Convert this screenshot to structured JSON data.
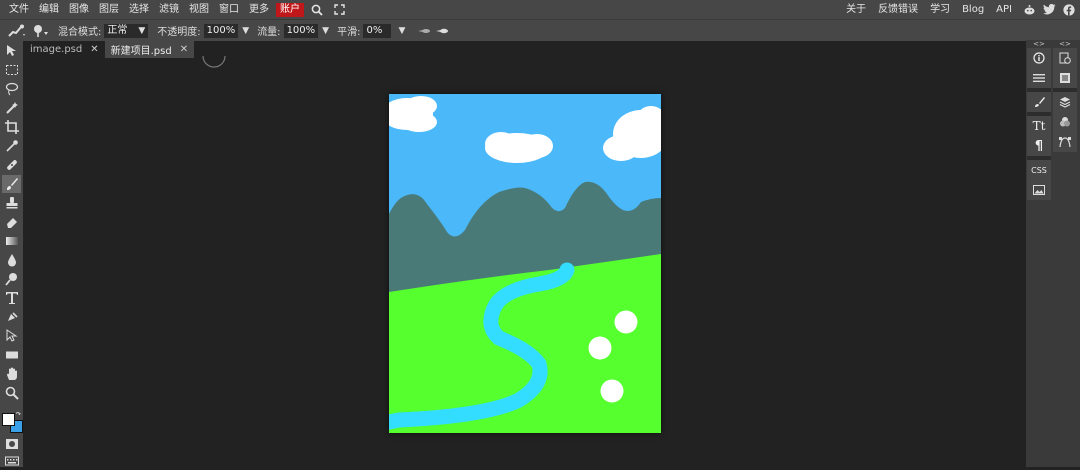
{
  "menu": {
    "items": [
      "文件",
      "编辑",
      "图像",
      "图层",
      "选择",
      "滤镜",
      "视图",
      "窗口",
      "更多"
    ],
    "account": "账户",
    "right_items": [
      "关于",
      "反馈错误",
      "学习",
      "Blog",
      "API"
    ]
  },
  "options": {
    "blend_label": "混合模式:",
    "blend_value": "正常",
    "opacity_label": "不透明度:",
    "opacity_value": "100%",
    "flow_label": "流量:",
    "flow_value": "100%",
    "smooth_label": "平滑:",
    "smooth_value": "0%"
  },
  "tabs": [
    {
      "label": "image.psd",
      "active": false
    },
    {
      "label": "新建项目.psd",
      "active": true
    }
  ],
  "tools": [
    "move-icon",
    "marquee-icon",
    "lasso-icon",
    "magic-wand-icon",
    "crop-icon",
    "eyedropper-icon",
    "healing-icon",
    "brush-icon",
    "stamp-icon",
    "eraser-icon",
    "gradient-icon",
    "blur-icon",
    "dodge-icon",
    "type-icon",
    "pen-icon",
    "path-select-icon",
    "shape-icon",
    "hand-icon",
    "zoom-icon"
  ],
  "colors": {
    "foreground": "#ffffff",
    "background": "#3aa0e8",
    "sky": "#4bb8fa",
    "mountain": "#4a7a78",
    "grass": "#56ff2e",
    "river": "#33ddff",
    "cloud": "#ffffff",
    "accent_red": "#c0171b"
  },
  "right_panel": {
    "toggle_left": "<>",
    "toggle_right": "<>",
    "css_label": "CSS",
    "type_label": "Tt",
    "paragraph_label": "¶"
  }
}
